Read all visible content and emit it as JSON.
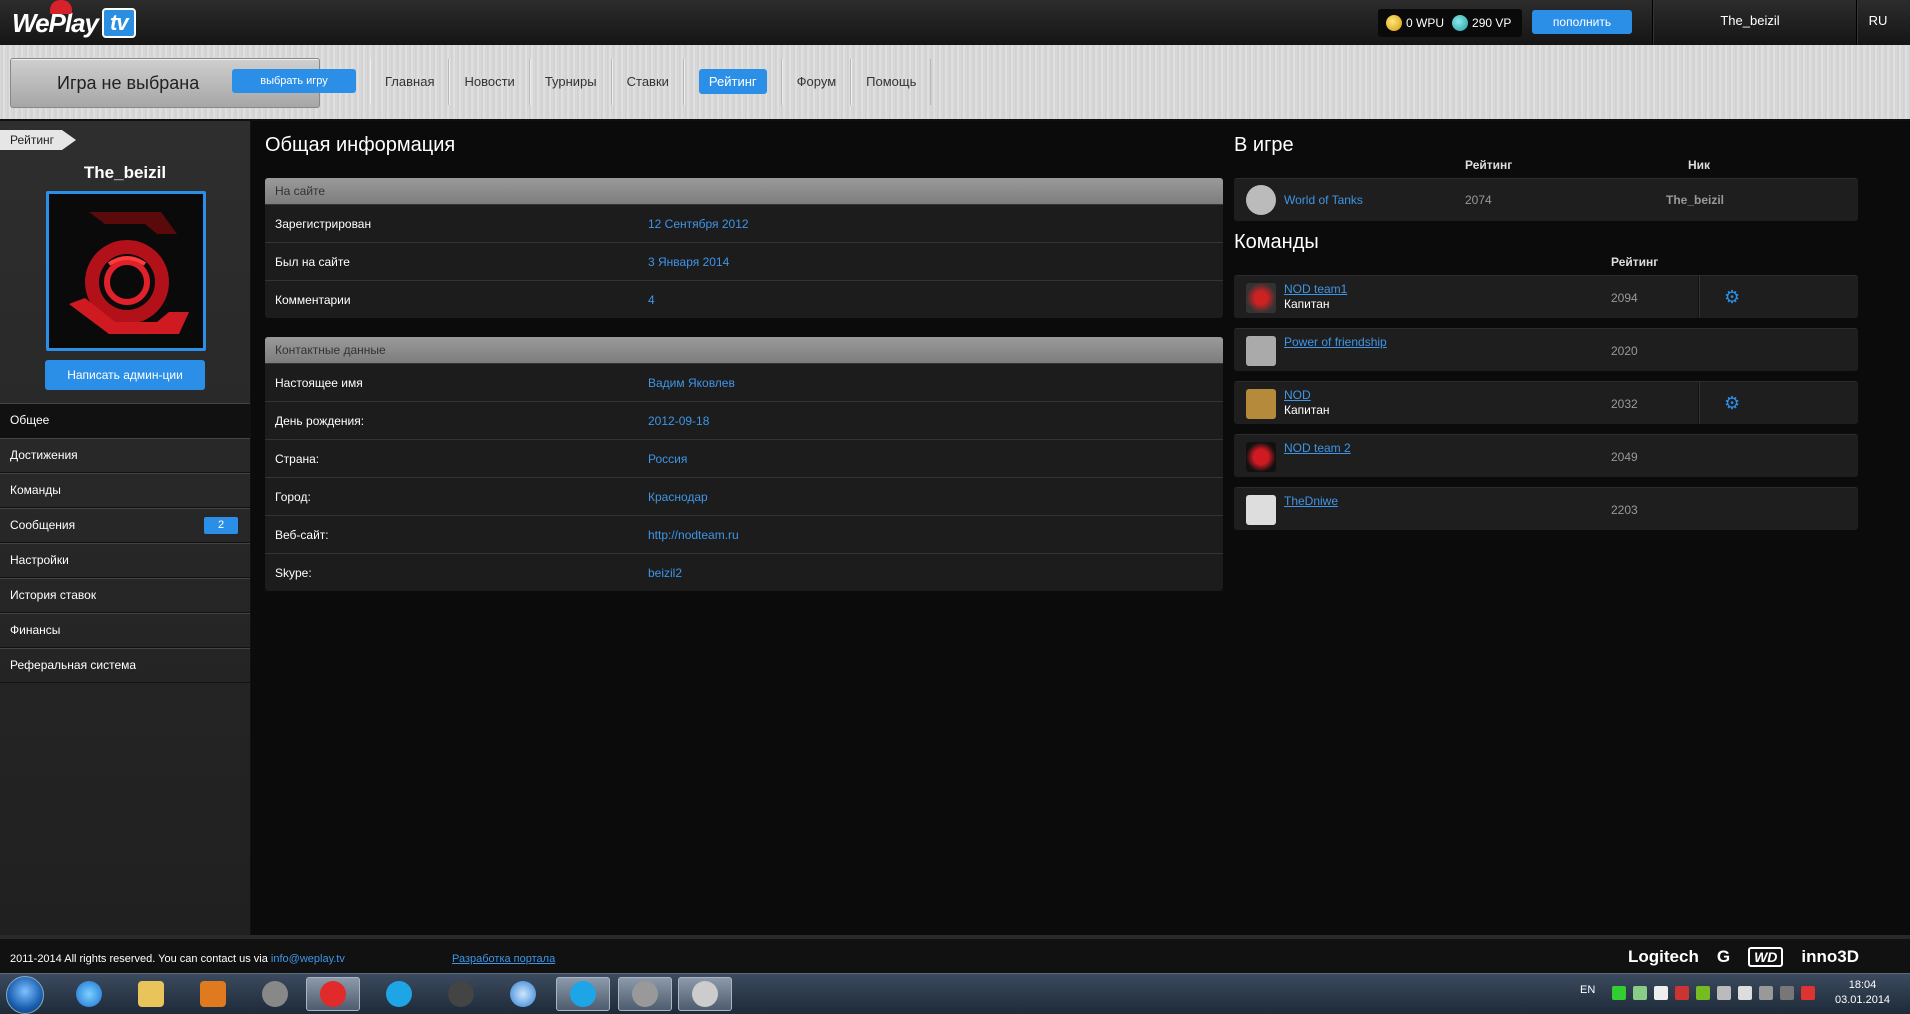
{
  "header": {
    "logo_text": "WePlay",
    "logo_tv": "tv",
    "wpu": "0 WPU",
    "vp": "290 VP",
    "topup_label": "пополнить",
    "username": "The_beizil",
    "lang": "RU"
  },
  "nav": {
    "game_title": "Игра не выбрана",
    "choose_game": "выбрать игру",
    "items": [
      "Главная",
      "Новости",
      "Турниры",
      "Ставки",
      "Рейтинг",
      "Форум",
      "Помощь"
    ],
    "active_index": 4
  },
  "sidebar": {
    "tag": "Рейтинг",
    "username": "The_beizil",
    "write_admin": "Написать админ-ции",
    "items": [
      "Общее",
      "Достижения",
      "Команды",
      "Сообщения",
      "Настройки",
      "История ставок",
      "Финансы",
      "Реферальная система"
    ],
    "messages_badge": "2"
  },
  "general": {
    "title": "Общая информация",
    "site_section": "На сайте",
    "site_rows": [
      {
        "label": "Зарегистрирован",
        "value": "12 Сентября 2012"
      },
      {
        "label": "Был на сайте",
        "value": "3 Января 2014"
      },
      {
        "label": "Комментарии",
        "value": "4"
      }
    ],
    "contact_section": "Контактные данные",
    "contact_rows": [
      {
        "label": "Настоящее имя",
        "value": "Вадим Яковлев"
      },
      {
        "label": "День рождения:",
        "value": "2012-09-18"
      },
      {
        "label": "Страна:",
        "value": "Россия"
      },
      {
        "label": "Город:",
        "value": "Краснодар"
      },
      {
        "label": "Веб-сайт:",
        "value": "http://nodteam.ru"
      },
      {
        "label": "Skype:",
        "value": "beizil2"
      }
    ]
  },
  "in_game": {
    "title": "В игре",
    "col_rating": "Рейтинг",
    "col_nick": "Ник",
    "rows": [
      {
        "game": "World of Tanks",
        "rating": "2074",
        "nick": "The_beizil"
      }
    ]
  },
  "teams": {
    "title": "Команды",
    "col_rating": "Рейтинг",
    "rows": [
      {
        "name": "NOD team1",
        "role": "Капитан",
        "rating": "2094",
        "icon": "nod-logo-icon"
      },
      {
        "name": "Power of friendship",
        "role": "",
        "rating": "2020",
        "icon": "wot-logo-icon"
      },
      {
        "name": "NOD",
        "role": "Капитан",
        "rating": "2032",
        "icon": "default-avatar-icon"
      },
      {
        "name": "NOD team 2",
        "role": "",
        "rating": "2049",
        "icon": "nod-logo-icon"
      },
      {
        "name": "TheDniwe",
        "role": "",
        "rating": "2203",
        "icon": "team-logo-icon"
      }
    ]
  },
  "footer": {
    "copyright": "2011-2014 All rights reserved. You can contact us via",
    "email": "info@weplay.tv",
    "dev": "Разработка портала",
    "sponsors": [
      "Logitech",
      "G",
      "WD",
      "inno3D"
    ]
  },
  "taskbar": {
    "lang": "EN",
    "time": "18:04",
    "date": "03.01.2014"
  },
  "colors": {
    "accent": "#2b8fe8",
    "link": "#3f95e8"
  }
}
